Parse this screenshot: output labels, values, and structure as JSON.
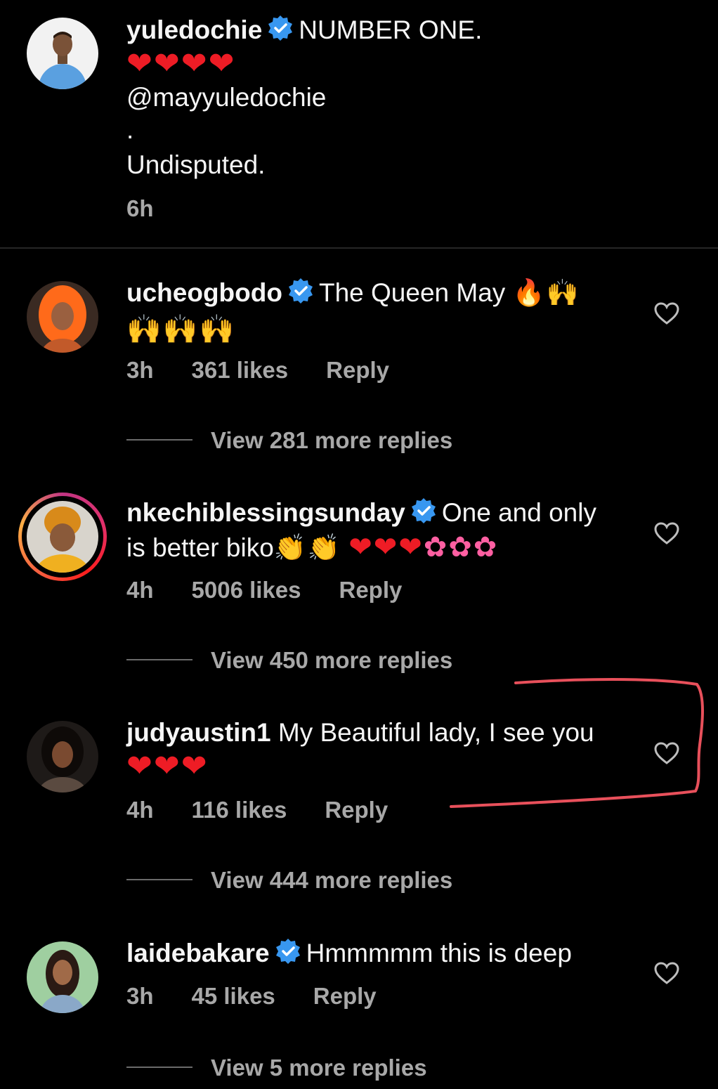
{
  "caption": {
    "username": "yuledochie",
    "verified": true,
    "line1_text": "NUMBER ONE.",
    "line2_emoji": "❤❤❤❤",
    "mention": "@mayyuledochie",
    "dot": ".",
    "line5_text": "Undisputed.",
    "time": "6h"
  },
  "comments": [
    {
      "username": "ucheogbodo",
      "verified": true,
      "text": "The Queen May",
      "text_emoji": "🔥🙌",
      "line2_emoji": "🙌🙌🙌",
      "time": "3h",
      "likes": "361 likes",
      "reply": "Reply",
      "view_more": "View 281 more replies"
    },
    {
      "username": "nkechiblessingsunday",
      "verified": true,
      "text": "One and only",
      "line2_text": "is better biko",
      "line2_emoji_clap": "👏👏",
      "line2_emoji_hearts": "❤❤❤",
      "line2_emoji_flowers": "✿✿✿",
      "time": "4h",
      "likes": "5006 likes",
      "reply": "Reply",
      "view_more": "View 450 more replies"
    },
    {
      "username": "judyaustin1",
      "verified": false,
      "text": "My Beautiful lady, I see you",
      "line2_emoji": "❤❤❤",
      "time": "4h",
      "likes": "116 likes",
      "reply": "Reply",
      "view_more": "View 444 more replies"
    },
    {
      "username": "laidebakare",
      "verified": true,
      "text": "Hmmmmm this is deep",
      "time": "3h",
      "likes": "45 likes",
      "reply": "Reply",
      "view_more": "View 5 more replies"
    }
  ],
  "colors": {
    "background": "#000000",
    "text": "#f5f5f5",
    "secondary": "#a8a8a8",
    "verified_blue": "#3897f0",
    "highlight_stroke": "#e8505b"
  }
}
